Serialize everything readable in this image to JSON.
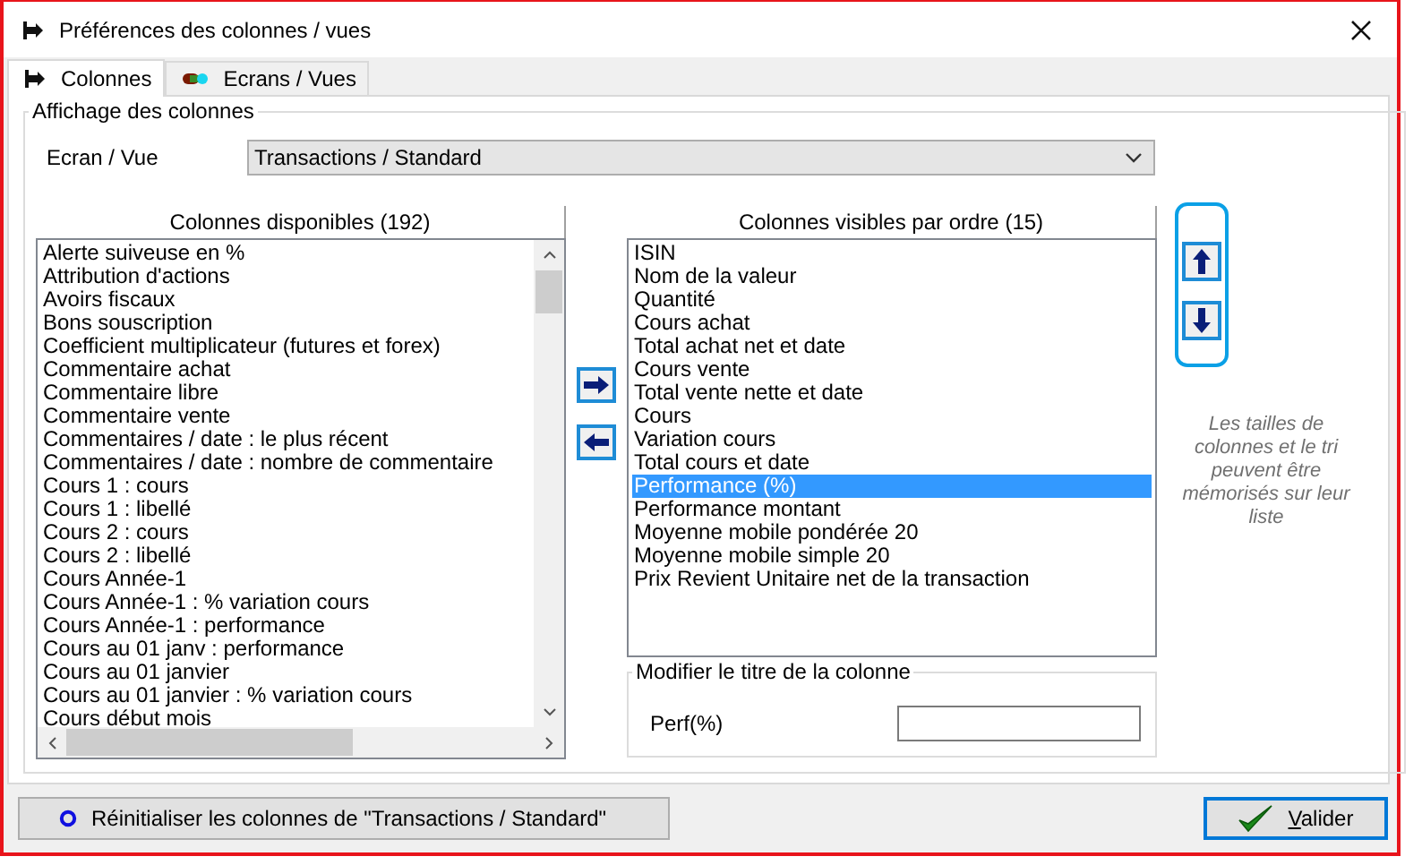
{
  "window": {
    "title": "Préférences des colonnes / vues"
  },
  "tabs": [
    {
      "label": "Colonnes",
      "kind": "columns",
      "selected": true
    },
    {
      "label": "Ecrans / Vues",
      "kind": "screens",
      "selected": false
    }
  ],
  "group": {
    "legend": "Affichage des colonnes"
  },
  "view_selector": {
    "label": "Ecran / Vue",
    "value": "Transactions / Standard"
  },
  "available": {
    "title": "Colonnes disponibles (192)",
    "items": [
      {
        "label": "Alerte suiveuse en %",
        "selected": false
      },
      {
        "label": "Attribution d'actions",
        "selected": false
      },
      {
        "label": "Avoirs fiscaux",
        "selected": false
      },
      {
        "label": "Bons souscription",
        "selected": false
      },
      {
        "label": "Coefficient multiplicateur (futures et forex)",
        "selected": false
      },
      {
        "label": "Commentaire achat",
        "selected": false
      },
      {
        "label": "Commentaire libre",
        "selected": false
      },
      {
        "label": "Commentaire vente",
        "selected": false
      },
      {
        "label": "Commentaires / date : le plus récent",
        "selected": false
      },
      {
        "label": "Commentaires / date : nombre de commentaire",
        "selected": false
      },
      {
        "label": "Cours 1 : cours",
        "selected": false
      },
      {
        "label": "Cours 1 : libellé",
        "selected": false
      },
      {
        "label": "Cours 2 : cours",
        "selected": false
      },
      {
        "label": "Cours 2 : libellé",
        "selected": false
      },
      {
        "label": "Cours Année-1",
        "selected": false
      },
      {
        "label": "Cours Année-1 : % variation cours",
        "selected": false
      },
      {
        "label": "Cours Année-1 : performance",
        "selected": false
      },
      {
        "label": "Cours au 01 janv : performance",
        "selected": false
      },
      {
        "label": "Cours au 01 janvier",
        "selected": false
      },
      {
        "label": "Cours au 01 janvier : % variation cours",
        "selected": false
      },
      {
        "label": "Cours début mois",
        "selected": false
      }
    ]
  },
  "visible": {
    "title": "Colonnes visibles par ordre (15)",
    "items": [
      {
        "label": "ISIN",
        "selected": false
      },
      {
        "label": "Nom de la valeur",
        "selected": false
      },
      {
        "label": "Quantité",
        "selected": false
      },
      {
        "label": "Cours achat",
        "selected": false
      },
      {
        "label": "Total achat net et date",
        "selected": false
      },
      {
        "label": "Cours vente",
        "selected": false
      },
      {
        "label": "Total vente nette et date",
        "selected": false
      },
      {
        "label": "Cours",
        "selected": false
      },
      {
        "label": "Variation cours",
        "selected": false
      },
      {
        "label": "Total cours et date",
        "selected": false
      },
      {
        "label": "Performance (%)",
        "selected": true
      },
      {
        "label": "Performance montant",
        "selected": false
      },
      {
        "label": "Moyenne mobile pondérée 20",
        "selected": false
      },
      {
        "label": "Moyenne mobile simple 20",
        "selected": false
      },
      {
        "label": "Prix Revient Unitaire net de la transaction",
        "selected": false
      }
    ]
  },
  "rename": {
    "legend": "Modifier le titre de la colonne",
    "label": "Perf(%)"
  },
  "hint": "Les tailles de colonnes et le tri peuvent être mémorisés sur leur liste",
  "reset_button": {
    "label": "Réinitialiser les colonnes de \"Transactions / Standard\""
  },
  "validate_button": {
    "label": "Valider"
  }
}
